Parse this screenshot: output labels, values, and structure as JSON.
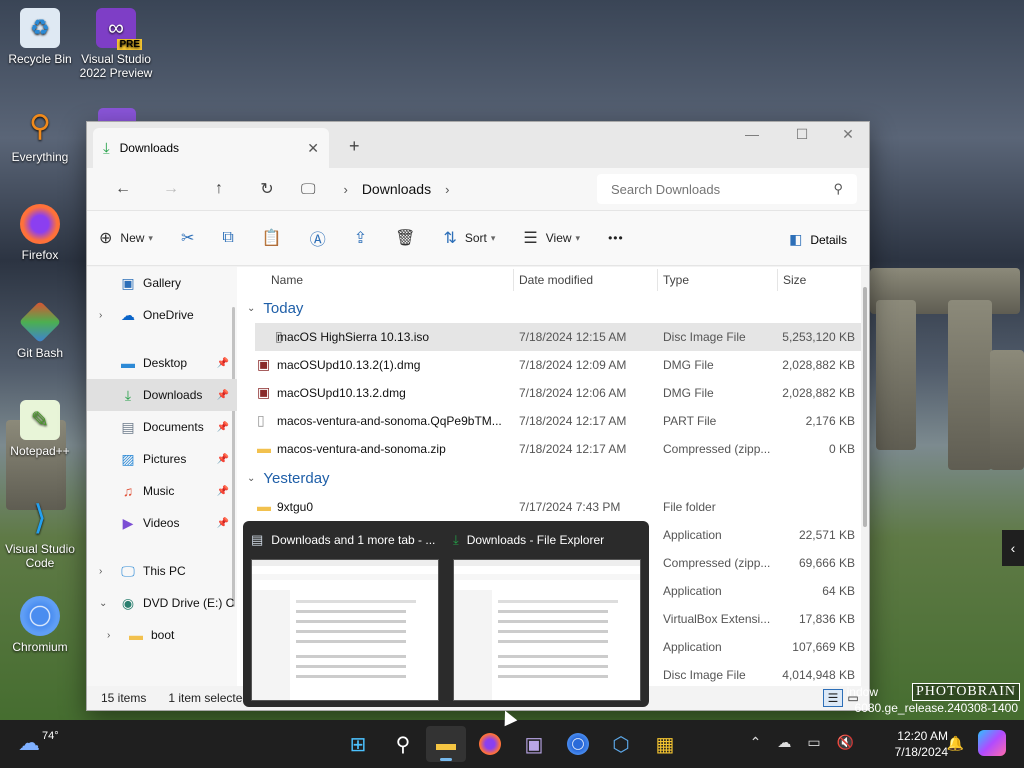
{
  "desktop": {
    "icons": [
      {
        "label": "Recycle Bin",
        "icon": "recycle-bin-icon"
      },
      {
        "label": "Visual Studio 2022 Preview",
        "icon": "visual-studio-preview-icon"
      },
      {
        "label": "Everything",
        "icon": "everything-icon"
      },
      {
        "label": "Firefox",
        "icon": "firefox-icon"
      },
      {
        "label": "Git Bash",
        "icon": "git-bash-icon"
      },
      {
        "label": "Notepad++",
        "icon": "notepadpp-icon"
      },
      {
        "label": "Visual Studio Code",
        "icon": "vscode-icon"
      },
      {
        "label": "Chromium",
        "icon": "chromium-icon"
      }
    ],
    "pre_badge": "PRE",
    "watermark_line1": "indow",
    "watermark_line2": "6080.ge_release.240308-1400",
    "photobrain": "PHOTOBRAIN"
  },
  "window": {
    "tab_label": "Downloads",
    "tab_close": "✕",
    "new_tab": "+",
    "controls": {
      "minimize": "—",
      "maximize": "☐",
      "close": "✕"
    },
    "breadcrumb": "Downloads",
    "search_placeholder": "Search Downloads",
    "toolbar": {
      "new": "New",
      "sort": "Sort",
      "view": "View",
      "more": "•••",
      "details": "Details"
    },
    "sidebar": [
      {
        "label": "Gallery",
        "icon": "gallery-icon",
        "pinned": false
      },
      {
        "label": "OneDrive",
        "icon": "onedrive-icon",
        "pinned": false,
        "expandable": true
      },
      {
        "label": "Desktop",
        "icon": "desktop-icon",
        "pinned": true
      },
      {
        "label": "Downloads",
        "icon": "downloads-icon",
        "pinned": true,
        "active": true
      },
      {
        "label": "Documents",
        "icon": "documents-icon",
        "pinned": true
      },
      {
        "label": "Pictures",
        "icon": "pictures-icon",
        "pinned": true
      },
      {
        "label": "Music",
        "icon": "music-icon",
        "pinned": true
      },
      {
        "label": "Videos",
        "icon": "videos-icon",
        "pinned": true
      },
      {
        "label": "This PC",
        "icon": "this-pc-icon",
        "expandable": true
      },
      {
        "label": "DVD Drive (E:) C",
        "icon": "dvd-drive-icon",
        "expanded": true
      },
      {
        "label": "boot",
        "icon": "folder-icon",
        "expandable": true
      }
    ],
    "columns": {
      "name": "Name",
      "date": "Date modified",
      "type": "Type",
      "size": "Size"
    },
    "groups": {
      "today": "Today",
      "yesterday": "Yesterday"
    },
    "today_files": [
      {
        "name": "macOS HighSierra 10.13.iso",
        "date": "7/18/2024 12:15 AM",
        "type": "Disc Image File",
        "size": "5,253,120 KB",
        "icon": "disc-image-icon",
        "selected": true
      },
      {
        "name": "macOSUpd10.13.2(1).dmg",
        "date": "7/18/2024 12:09 AM",
        "type": "DMG File",
        "size": "2,028,882 KB",
        "icon": "dmg-icon"
      },
      {
        "name": "macOSUpd10.13.2.dmg",
        "date": "7/18/2024 12:06 AM",
        "type": "DMG File",
        "size": "2,028,882 KB",
        "icon": "dmg-icon"
      },
      {
        "name": "macos-ventura-and-sonoma.QqPe9bTM...",
        "date": "7/18/2024 12:17 AM",
        "type": "PART File",
        "size": "2,176 KB",
        "icon": "file-icon"
      },
      {
        "name": "macos-ventura-and-sonoma.zip",
        "date": "7/18/2024 12:17 AM",
        "type": "Compressed (zipp...",
        "size": "0 KB",
        "icon": "zip-folder-icon"
      }
    ],
    "yesterday_files": [
      {
        "name": "9xtgu0",
        "date": "7/17/2024 7:43 PM",
        "type": "File folder",
        "size": "",
        "icon": "folder-icon"
      },
      {
        "name": "",
        "date": "",
        "type": "Application",
        "size": "22,571 KB",
        "icon": ""
      },
      {
        "name": "",
        "date": "",
        "type": "Compressed (zipp...",
        "size": "69,666 KB",
        "icon": ""
      },
      {
        "name": "",
        "date": "",
        "type": "Application",
        "size": "64 KB",
        "icon": ""
      },
      {
        "name": "",
        "date": "",
        "type": "VirtualBox Extensi...",
        "size": "17,836 KB",
        "icon": ""
      },
      {
        "name": "",
        "date": "",
        "type": "Application",
        "size": "107,669 KB",
        "icon": ""
      },
      {
        "name": "",
        "date": "",
        "type": "Disc Image File",
        "size": "4,014,948 KB",
        "icon": ""
      }
    ],
    "status": {
      "items": "15 items",
      "selected": "1 item selected"
    }
  },
  "preview": {
    "items": [
      {
        "title": "Downloads and 1 more tab - ...",
        "icon": "file-explorer-icon"
      },
      {
        "title": "Downloads - File Explorer",
        "icon": "downloads-icon"
      }
    ]
  },
  "taskbar": {
    "weather_temp": "74°",
    "apps": [
      "windows-start-icon",
      "search-icon",
      "file-explorer-icon",
      "firefox-icon",
      "app-icon",
      "chromium-icon",
      "virtualbox-icon",
      "store-icon"
    ],
    "time": "12:20 AM",
    "date": "7/18/2024"
  },
  "colors": {
    "accent": "#2d6fb8",
    "download_green": "#23a047",
    "taskbar": "#1f1f1f"
  }
}
